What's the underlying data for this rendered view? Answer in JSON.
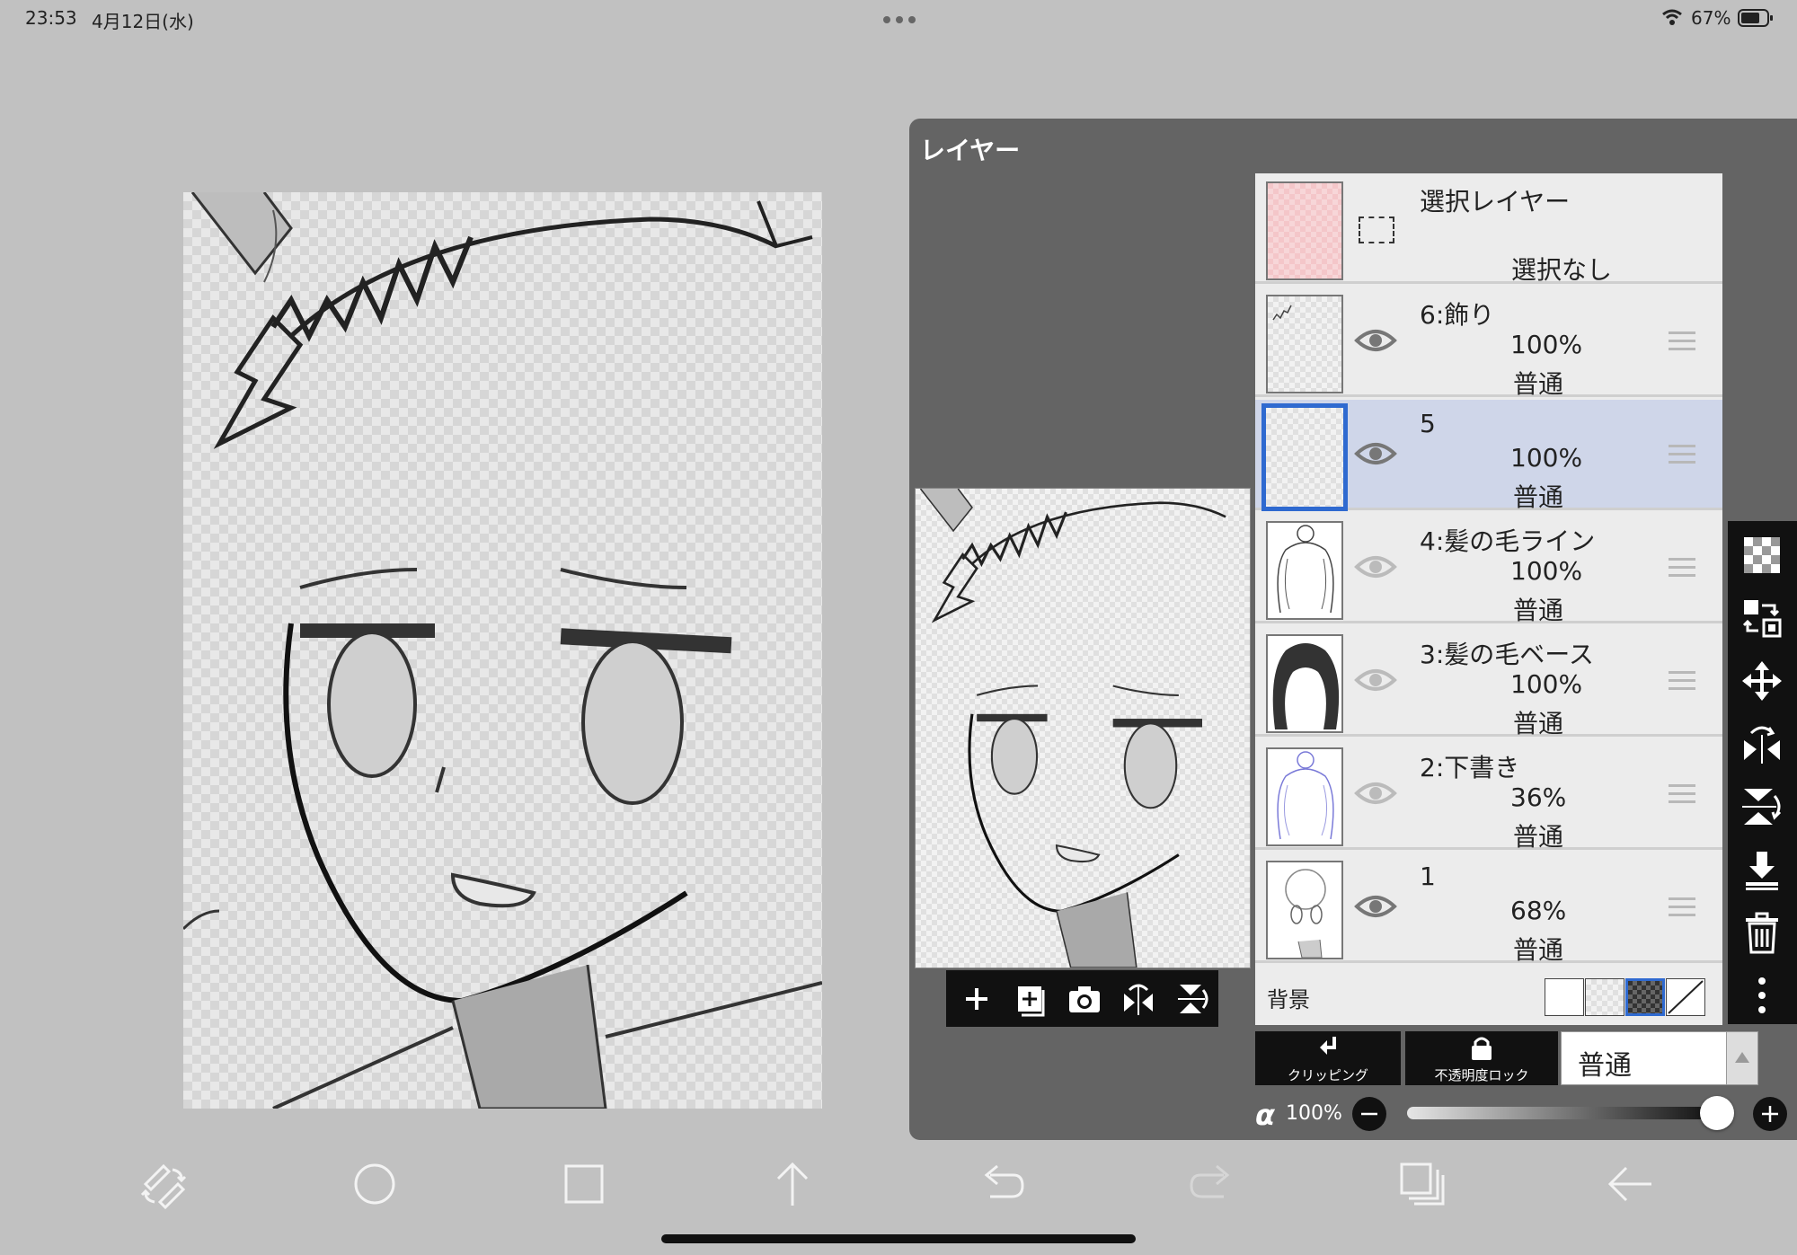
{
  "status_bar": {
    "time": "23:53",
    "date": "4月12日(水)",
    "battery": "67%",
    "icons": [
      "more-dots-icon",
      "wifi-icon",
      "battery-icon"
    ]
  },
  "layer_panel": {
    "title": "レイヤー",
    "selection_layer": {
      "name": "選択レイヤー",
      "status": "選択なし"
    },
    "layers": [
      {
        "name": "6:飾り",
        "opacity": "100%",
        "blend": "普通",
        "visible": true,
        "selected": false
      },
      {
        "name": "5",
        "opacity": "100%",
        "blend": "普通",
        "visible": true,
        "selected": true
      },
      {
        "name": "4:髪の毛ライン",
        "opacity": "100%",
        "blend": "普通",
        "visible": false,
        "selected": false
      },
      {
        "name": "3:髪の毛ベース",
        "opacity": "100%",
        "blend": "普通",
        "visible": false,
        "selected": false
      },
      {
        "name": "2:下書き",
        "opacity": "36%",
        "blend": "普通",
        "visible": false,
        "selected": false
      },
      {
        "name": "1",
        "opacity": "68%",
        "blend": "普通",
        "visible": true,
        "selected": false
      }
    ],
    "background": {
      "label": "背景",
      "options": [
        "white",
        "checker",
        "dark-checker",
        "none"
      ],
      "selected": "dark-checker"
    },
    "clipping_label": "クリッピング",
    "opacity_lock_label": "不透明度ロック",
    "blend_mode_value": "普通",
    "alpha_symbol": "α",
    "alpha_value": "100%",
    "alpha_level": 1.0
  },
  "preview_tools": [
    "add-layer-icon",
    "add-layer-copy-icon",
    "camera-icon",
    "flip-horizontal-icon",
    "flip-vertical-icon"
  ],
  "right_tools": [
    "transparent-icon",
    "transform-select-icon",
    "move-icon",
    "flip-h-icon",
    "flip-v-icon",
    "merge-down-icon",
    "trash-icon",
    "more-vertical-icon"
  ],
  "bottom_toolbar": [
    "brush-swap-icon",
    "circle-icon",
    "square-icon",
    "upload-arrow-icon",
    "undo-icon",
    "redo-icon",
    "layers-icon",
    "back-arrow-icon"
  ],
  "colors": {
    "app_bg": "#c1c1c1",
    "panel_bg": "#646464",
    "selected_row": "#cfd6e9",
    "accent": "#2f6ad0"
  }
}
